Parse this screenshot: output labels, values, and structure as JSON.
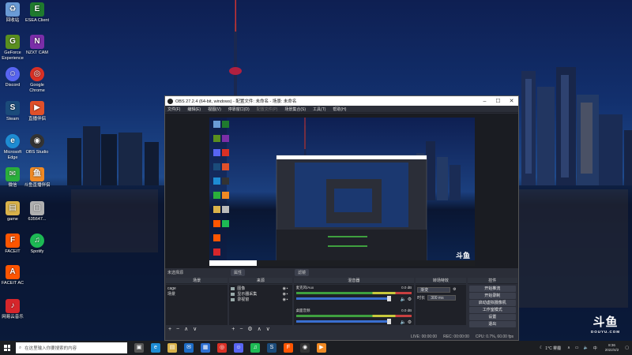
{
  "desktop_icons": [
    {
      "label": "回收站",
      "icon": "recycle-bin-icon",
      "color": "#6a9bd6"
    },
    {
      "label": "ESEA Client",
      "icon": "esea-icon",
      "color": "#1f7a2e"
    },
    {
      "label": "GeForce Experience",
      "icon": "geforce-icon",
      "color": "#5a8f1f"
    },
    {
      "label": "NZXT CAM",
      "icon": "nzxt-icon",
      "color": "#7b2ea8"
    },
    {
      "label": "Discord",
      "icon": "discord-icon",
      "color": "#5865f2"
    },
    {
      "label": "Google Chrome",
      "icon": "chrome-icon",
      "color": "#d93025"
    },
    {
      "label": "Steam",
      "icon": "steam-icon",
      "color": "#1b4b7a"
    },
    {
      "label": "直播伴侣",
      "icon": "live-companion-icon",
      "color": "#e0502a"
    },
    {
      "label": "Microsoft Edge",
      "icon": "edge-icon",
      "color": "#1e8cd3"
    },
    {
      "label": "OBS Studio",
      "icon": "obs-icon",
      "color": "#333333"
    },
    {
      "label": "微信",
      "icon": "wechat-icon",
      "color": "#2aae3b"
    },
    {
      "label": "斗鱼直播伴侣",
      "icon": "douyu-icon",
      "color": "#f08a24"
    },
    {
      "label": "game",
      "icon": "folder-icon",
      "color": "#d9b24a"
    },
    {
      "label": "635647...",
      "icon": "file-icon",
      "color": "#b0b0b0"
    },
    {
      "label": "FACEIT",
      "icon": "faceit-icon",
      "color": "#ff5500"
    },
    {
      "label": "Spotify",
      "icon": "spotify-icon",
      "color": "#1db954"
    },
    {
      "label": "FACEIT AC",
      "icon": "faceit-ac-icon",
      "color": "#ff5500"
    },
    {
      "label": "网易云音乐",
      "icon": "netease-music-icon",
      "color": "#d6262b"
    }
  ],
  "obs": {
    "title": "OBS 27.2.4 (64-bit, windows) - 配置文件: 未命名 - 场景: 未命名",
    "menu": [
      "文件(F)",
      "编辑(E)",
      "视图(V)",
      "停靠窗口(D)",
      "配置文件(P)",
      "场景集合(S)",
      "工具(T)",
      "帮助(H)"
    ],
    "preview_label": "未选择源",
    "ctrl_buttons": [
      "属性",
      "滤镜"
    ],
    "docks": {
      "scenes": {
        "title": "场景",
        "items": [
          "cage",
          "场景"
        ]
      },
      "sources": {
        "title": "来源",
        "items": [
          "图像",
          "显示器采集",
          "录视窗"
        ]
      },
      "mixer": {
        "title": "混音器",
        "channels": [
          {
            "name": "麦克风/Aux",
            "level": "0.0 dB"
          },
          {
            "name": "桌面音频",
            "level": "0.0 dB"
          }
        ]
      },
      "transitions": {
        "title": "转场特效",
        "type": "渐变",
        "duration_label": "时长",
        "duration": "300 ms"
      },
      "controls": {
        "title": "控件",
        "buttons": [
          "开始推流",
          "开始录制",
          "启动虚拟摄像机",
          "工作室模式",
          "设置",
          "退出"
        ]
      }
    },
    "status": {
      "live": "LIVE: 00:00:00",
      "rec": "REC: 00:00:00",
      "cpu": "CPU: 0.7%, 60.00 fps"
    }
  },
  "taskbar": {
    "search_placeholder": "在这里输入你要搜索的内容",
    "apps": [
      {
        "icon": "task-view-icon",
        "color": "#555555"
      },
      {
        "icon": "edge-icon",
        "color": "#1e8cd3"
      },
      {
        "icon": "file-explorer-icon",
        "color": "#d9b24a"
      },
      {
        "icon": "mail-icon",
        "color": "#1c6bc4"
      },
      {
        "icon": "store-icon",
        "color": "#2d6fd1"
      },
      {
        "icon": "chrome-icon",
        "color": "#d93025"
      },
      {
        "icon": "discord-icon",
        "color": "#5865f2"
      },
      {
        "icon": "spotify-icon",
        "color": "#1db954"
      },
      {
        "icon": "steam-icon",
        "color": "#1b4b7a"
      },
      {
        "icon": "faceit-icon",
        "color": "#ff5500"
      },
      {
        "icon": "obs-icon",
        "color": "#333333"
      },
      {
        "icon": "live-companion-icon",
        "color": "#f08a24"
      }
    ],
    "weather": "1°C 雾霾",
    "ime": "中",
    "time": "8:36",
    "date": "2022/4/2"
  },
  "watermark": {
    "logo": "斗鱼",
    "site": "DOUYU.COM"
  }
}
